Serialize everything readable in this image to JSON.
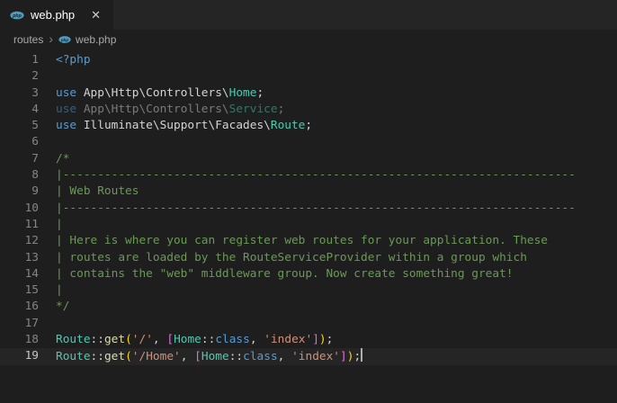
{
  "colors": {
    "editor_bg": "#1e1e1e",
    "tabbar_bg": "#252526",
    "tab_text": "#ffffff",
    "breadcrumb_text": "#a9a9a9",
    "linenum": "#858585",
    "linenum_active": "#c6c6c6",
    "kw": "#569cd6",
    "def": "#d4d4d4",
    "cls": "#4ec9b0",
    "fn": "#dcdcaa",
    "str": "#ce9178",
    "cm": "#6a9955",
    "b1": "#ffd700",
    "b2": "#da70d6",
    "cursor": "#aeafad",
    "php_icon_blue": "#519aba"
  },
  "tab": {
    "label": "web.php",
    "close_glyph": "✕"
  },
  "breadcrumb": {
    "folder": "routes",
    "separator": "›",
    "file": "web.php"
  },
  "icons": {
    "php_label": "php"
  },
  "editor": {
    "lines": [
      {
        "num": 1,
        "tokens": [
          {
            "c": "kw",
            "t": "<?php"
          }
        ]
      },
      {
        "num": 2,
        "tokens": []
      },
      {
        "num": 3,
        "tokens": [
          {
            "c": "kw",
            "t": "use"
          },
          {
            "c": "def",
            "t": " App\\Http\\Controllers\\"
          },
          {
            "c": "cls",
            "t": "Home"
          },
          {
            "c": "def",
            "t": ";"
          }
        ]
      },
      {
        "num": 4,
        "tokens": [
          {
            "c": "kw",
            "t": "use",
            "dim": true
          },
          {
            "c": "def",
            "t": " App\\Http\\Controllers\\",
            "dim": true
          },
          {
            "c": "cls",
            "t": "Service",
            "dim": true
          },
          {
            "c": "def",
            "t": ";",
            "dim": true
          }
        ]
      },
      {
        "num": 5,
        "tokens": [
          {
            "c": "kw",
            "t": "use"
          },
          {
            "c": "def",
            "t": " Illuminate\\Support\\Facades\\"
          },
          {
            "c": "cls",
            "t": "Route"
          },
          {
            "c": "def",
            "t": ";"
          }
        ]
      },
      {
        "num": 6,
        "tokens": []
      },
      {
        "num": 7,
        "tokens": [
          {
            "c": "cm",
            "t": "/*"
          }
        ]
      },
      {
        "num": 8,
        "tokens": [
          {
            "c": "cm",
            "t": "|--------------------------------------------------------------------------"
          }
        ]
      },
      {
        "num": 9,
        "tokens": [
          {
            "c": "cm",
            "t": "| Web Routes"
          }
        ]
      },
      {
        "num": 10,
        "tokens": [
          {
            "c": "cm",
            "t": "|--------------------------------------------------------------------------"
          }
        ]
      },
      {
        "num": 11,
        "tokens": [
          {
            "c": "cm",
            "t": "|"
          }
        ]
      },
      {
        "num": 12,
        "tokens": [
          {
            "c": "cm",
            "t": "| Here is where you can register web routes for your application. These"
          }
        ]
      },
      {
        "num": 13,
        "tokens": [
          {
            "c": "cm",
            "t": "| routes are loaded by the RouteServiceProvider within a group which"
          }
        ]
      },
      {
        "num": 14,
        "tokens": [
          {
            "c": "cm",
            "t": "| contains the \"web\" middleware group. Now create something great!"
          }
        ]
      },
      {
        "num": 15,
        "tokens": [
          {
            "c": "cm",
            "t": "|"
          }
        ]
      },
      {
        "num": 16,
        "tokens": [
          {
            "c": "cm",
            "t": "*/"
          }
        ]
      },
      {
        "num": 17,
        "tokens": []
      },
      {
        "num": 18,
        "tokens": [
          {
            "c": "cls",
            "t": "Route"
          },
          {
            "c": "def",
            "t": "::"
          },
          {
            "c": "fn",
            "t": "get"
          },
          {
            "c": "b1",
            "t": "("
          },
          {
            "c": "str",
            "t": "'/'"
          },
          {
            "c": "def",
            "t": ", "
          },
          {
            "c": "b2",
            "t": "["
          },
          {
            "c": "cls",
            "t": "Home"
          },
          {
            "c": "def",
            "t": "::"
          },
          {
            "c": "kw",
            "t": "class"
          },
          {
            "c": "def",
            "t": ", "
          },
          {
            "c": "str",
            "t": "'index'"
          },
          {
            "c": "b2",
            "t": "]"
          },
          {
            "c": "b1",
            "t": ")"
          },
          {
            "c": "def",
            "t": ";"
          }
        ]
      },
      {
        "num": 19,
        "active": true,
        "cursor": true,
        "tokens": [
          {
            "c": "cls",
            "t": "Route"
          },
          {
            "c": "def",
            "t": "::"
          },
          {
            "c": "fn",
            "t": "get"
          },
          {
            "c": "b1",
            "t": "("
          },
          {
            "c": "str",
            "t": "'/Home'"
          },
          {
            "c": "def",
            "t": ", "
          },
          {
            "c": "b2",
            "t": "["
          },
          {
            "c": "cls",
            "t": "Home"
          },
          {
            "c": "def",
            "t": "::"
          },
          {
            "c": "kw",
            "t": "class"
          },
          {
            "c": "def",
            "t": ", "
          },
          {
            "c": "str",
            "t": "'index'"
          },
          {
            "c": "b2",
            "t": "]"
          },
          {
            "c": "b1",
            "t": ")"
          },
          {
            "c": "def",
            "t": ";"
          }
        ]
      }
    ]
  }
}
